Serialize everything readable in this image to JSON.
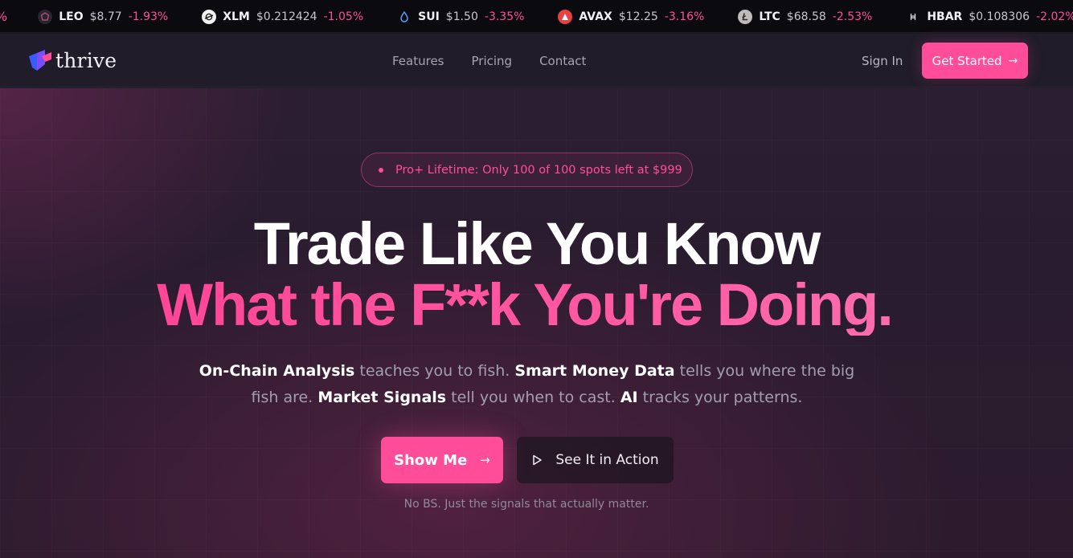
{
  "ticker": {
    "leading_fragment": "%",
    "items": [
      {
        "icon": "leo-icon",
        "symbol": "LEO",
        "price": "$8.77",
        "change": "-1.93%",
        "icon_bg": "#2a2630",
        "icon_color": "#c04f7e"
      },
      {
        "icon": "xlm-icon",
        "symbol": "XLM",
        "price": "$0.212424",
        "change": "-1.05%",
        "icon_bg": "#f2f2f2",
        "icon_color": "#111111"
      },
      {
        "icon": "sui-icon",
        "symbol": "SUI",
        "price": "$1.50",
        "change": "-3.35%",
        "icon_bg": "#0b0a0f",
        "icon_color": "#4da2ff"
      },
      {
        "icon": "avax-icon",
        "symbol": "AVAX",
        "price": "$12.25",
        "change": "-3.16%",
        "icon_bg": "#e84142",
        "icon_color": "#ffffff"
      },
      {
        "icon": "ltc-icon",
        "symbol": "LTC",
        "price": "$68.58",
        "change": "-2.53%",
        "icon_bg": "#bfbbbb",
        "icon_color": "#2a2a2a"
      },
      {
        "icon": "hbar-icon",
        "symbol": "HBAR",
        "price": "$0.108306",
        "change": "-2.02%",
        "icon_bg": "#0b0a0f",
        "icon_color": "#d9d9d9"
      }
    ]
  },
  "nav": {
    "logo_text": "thrive",
    "links": [
      "Features",
      "Pricing",
      "Contact"
    ],
    "sign_in": "Sign In",
    "get_started": "Get Started"
  },
  "hero": {
    "pill_text": "Pro+ Lifetime: Only 100 of 100 spots left at $999",
    "headline_line1": "Trade Like You Know",
    "headline_line2": "What the F**k You're Doing.",
    "sub": {
      "b1": "On-Chain Analysis",
      "t1": " teaches you to fish. ",
      "b2": "Smart Money Data",
      "t2": " tells you where the big fish are. ",
      "b3": "Market Signals",
      "t3": " tell you when to cast. ",
      "b4": "AI",
      "t4": " tracks your patterns."
    },
    "primary_button": "Show Me",
    "secondary_button": "See It in Action",
    "tagline": "No BS. Just the signals that actually matter."
  },
  "colors": {
    "accent": "#ff4d9a",
    "negative_change": "#ff4f9a",
    "background": "#1d1827"
  }
}
